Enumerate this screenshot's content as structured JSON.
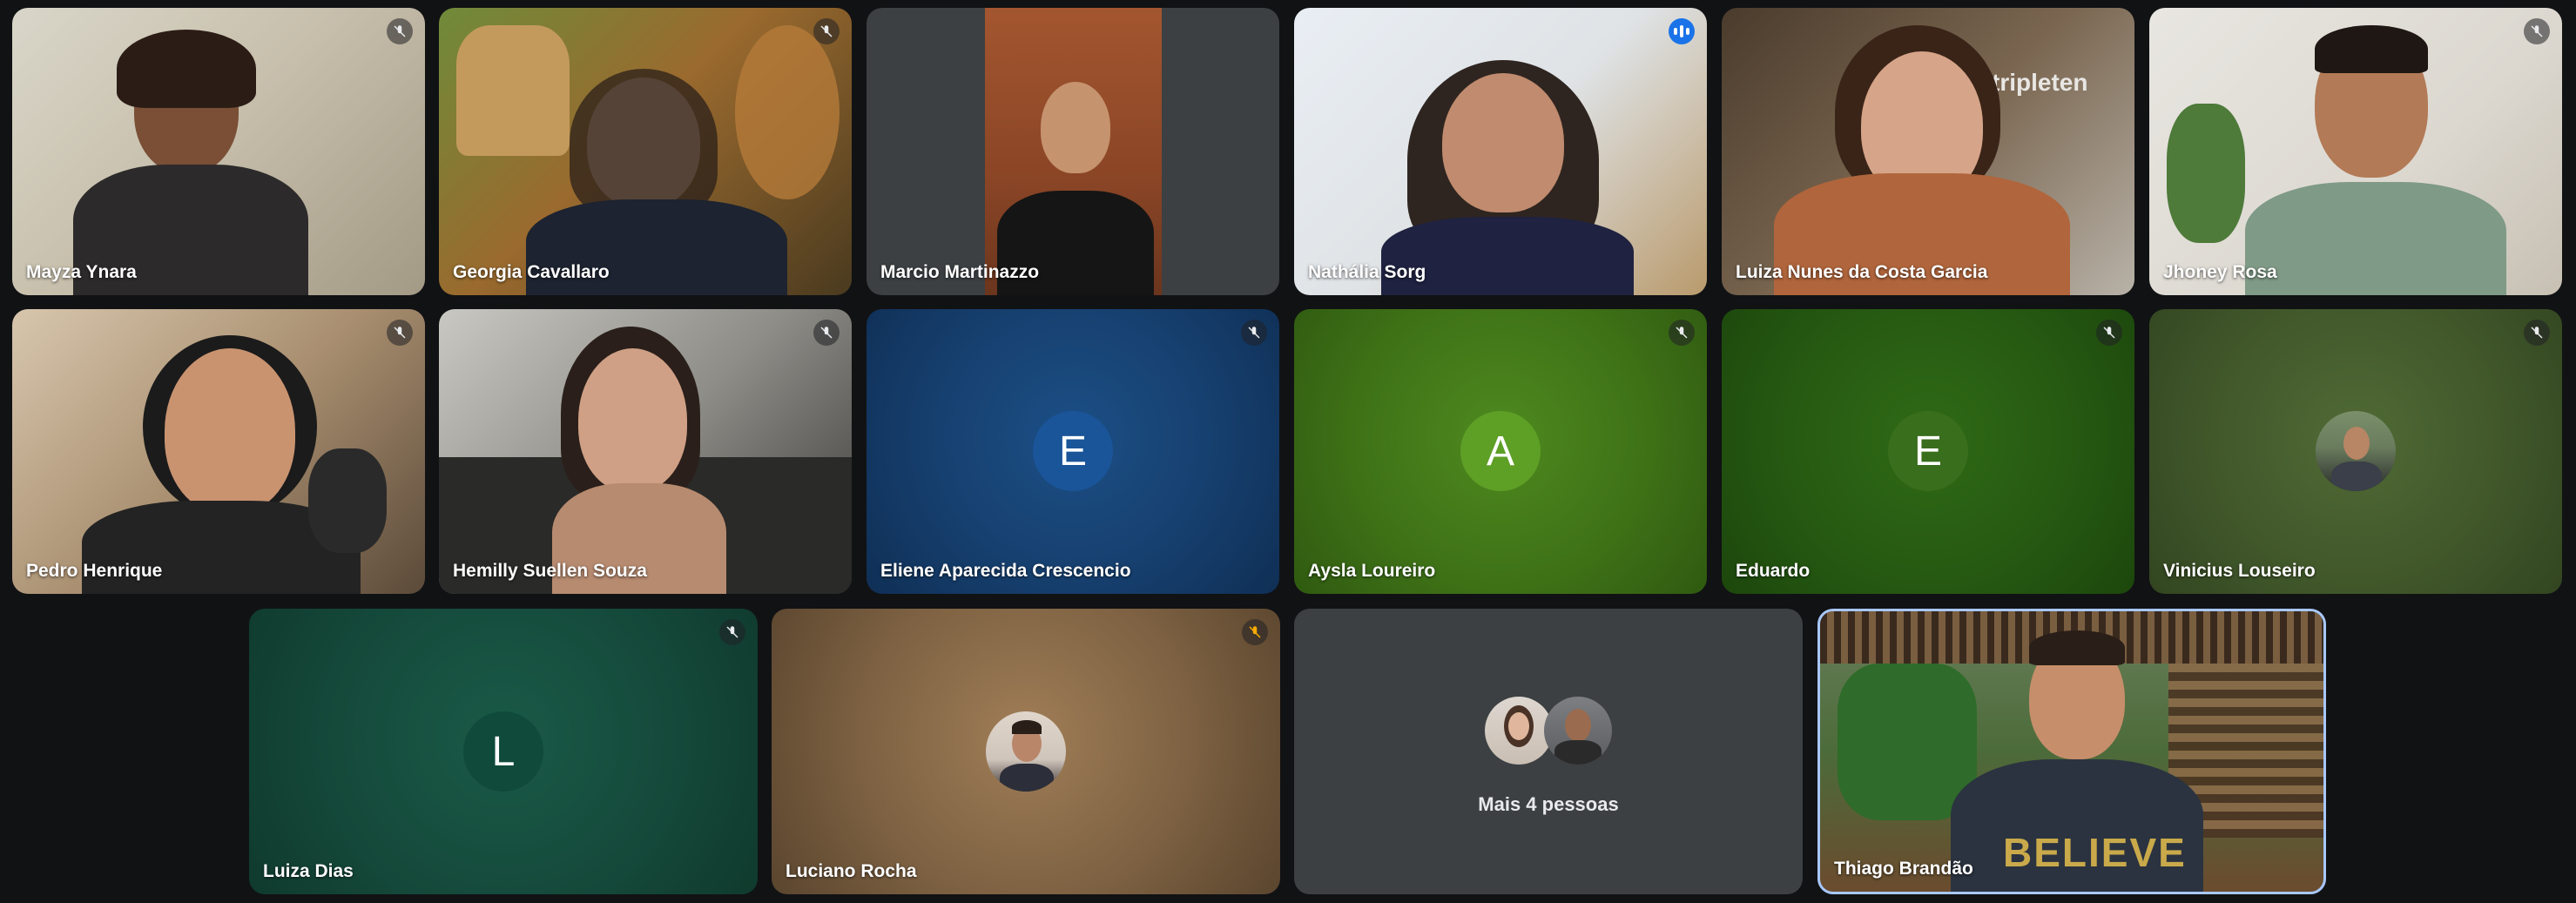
{
  "participants": [
    {
      "name": "Mayza Ynara",
      "muted": true
    },
    {
      "name": "Georgia Cavallaro",
      "muted": true
    },
    {
      "name": "Marcio Martinazzo",
      "muted": false
    },
    {
      "name": "Nathália Sorg",
      "speaking": true
    },
    {
      "name": "Luiza Nunes da Costa Garcia",
      "muted": false
    },
    {
      "name": "Jhoney Rosa",
      "muted": true
    },
    {
      "name": "Pedro Henrique",
      "muted": true
    },
    {
      "name": "Hemilly Suellen Souza",
      "muted": true
    },
    {
      "name": "Eliene Aparecida Crescencio",
      "muted": true,
      "initial": "E",
      "avatar_color": "#1a5599"
    },
    {
      "name": "Aysla Loureiro",
      "muted": true,
      "initial": "A",
      "avatar_color": "#5e9f26"
    },
    {
      "name": "Eduardo",
      "muted": true,
      "initial": "E",
      "avatar_color": "#386e1c"
    },
    {
      "name": "Vinicius Louseiro",
      "muted": true
    },
    {
      "name": "Luiza Dias",
      "muted": true,
      "initial": "L",
      "avatar_color": "#0f4a3a"
    },
    {
      "name": "Luciano Rocha",
      "muted": true
    },
    {
      "name": "Thiago Brandão",
      "muted": false,
      "pinned": true
    }
  ],
  "more_tile": {
    "label": "Mais 4 pessoas"
  },
  "presenter_shirt_text": "BELIEVE",
  "wall_sign": "tripleten"
}
